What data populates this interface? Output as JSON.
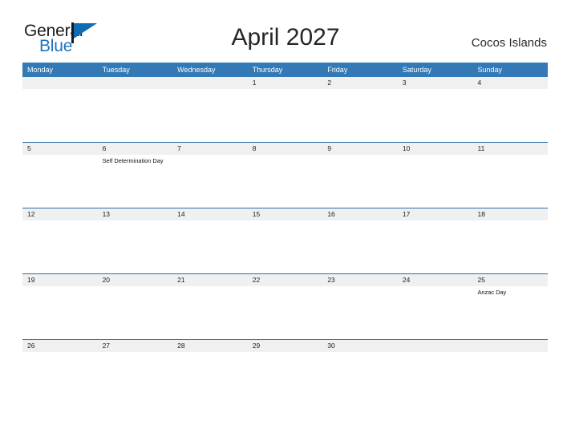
{
  "logo": {
    "word_one": "General",
    "word_two": "Blue",
    "flag_icon": "flag-triangle-icon",
    "accent_color": "#0d6cb4"
  },
  "header": {
    "title": "April 2027",
    "location": "Cocos Islands"
  },
  "theme": {
    "header_blue": "#3279b6",
    "rule_blue": "#2e6da4",
    "band_gray": "#f0f0f0",
    "text_dark": "#222222"
  },
  "calendar": {
    "weekday_headers": [
      "Monday",
      "Tuesday",
      "Wednesday",
      "Thursday",
      "Friday",
      "Saturday",
      "Sunday"
    ],
    "weeks": [
      [
        {
          "day": "",
          "events": []
        },
        {
          "day": "",
          "events": []
        },
        {
          "day": "",
          "events": []
        },
        {
          "day": "1",
          "events": []
        },
        {
          "day": "2",
          "events": []
        },
        {
          "day": "3",
          "events": []
        },
        {
          "day": "4",
          "events": []
        }
      ],
      [
        {
          "day": "5",
          "events": []
        },
        {
          "day": "6",
          "events": [
            "Self Determination Day"
          ]
        },
        {
          "day": "7",
          "events": []
        },
        {
          "day": "8",
          "events": []
        },
        {
          "day": "9",
          "events": []
        },
        {
          "day": "10",
          "events": []
        },
        {
          "day": "11",
          "events": []
        }
      ],
      [
        {
          "day": "12",
          "events": []
        },
        {
          "day": "13",
          "events": []
        },
        {
          "day": "14",
          "events": []
        },
        {
          "day": "15",
          "events": []
        },
        {
          "day": "16",
          "events": []
        },
        {
          "day": "17",
          "events": []
        },
        {
          "day": "18",
          "events": []
        }
      ],
      [
        {
          "day": "19",
          "events": []
        },
        {
          "day": "20",
          "events": []
        },
        {
          "day": "21",
          "events": []
        },
        {
          "day": "22",
          "events": []
        },
        {
          "day": "23",
          "events": []
        },
        {
          "day": "24",
          "events": []
        },
        {
          "day": "25",
          "events": [
            "Anzac Day"
          ]
        }
      ],
      [
        {
          "day": "26",
          "events": []
        },
        {
          "day": "27",
          "events": []
        },
        {
          "day": "28",
          "events": []
        },
        {
          "day": "29",
          "events": []
        },
        {
          "day": "30",
          "events": []
        },
        {
          "day": "",
          "events": []
        },
        {
          "day": "",
          "events": []
        }
      ]
    ]
  }
}
